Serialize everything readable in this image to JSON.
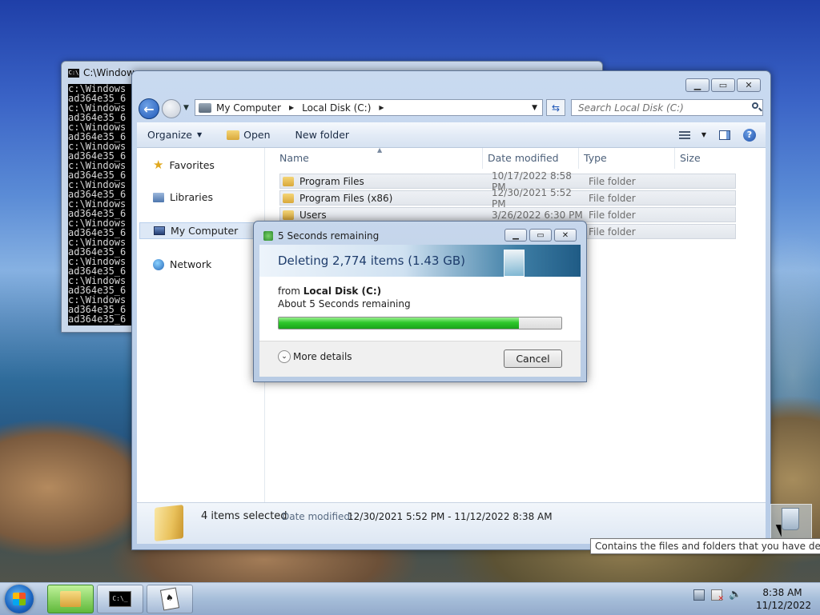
{
  "console": {
    "title": "C:\\Window",
    "lines": [
      "c:\\Windows",
      "ad364e35_6",
      "c:\\Windows",
      "ad364e35_6",
      "c:\\Windows",
      "ad364e35_6",
      "c:\\Windows",
      "ad364e35_6",
      "c:\\Windows",
      "ad364e35_6",
      "c:\\Windows",
      "ad364e35_6",
      "c:\\Windows",
      "ad364e35_6",
      "c:\\Windows",
      "ad364e35_6",
      "c:\\Windows",
      "ad364e35_6",
      "c:\\Windows",
      "ad364e35_6",
      "c:\\Windows",
      "ad364e35_6",
      "c:\\Windows",
      "ad364e35_6",
      "ad364e35_6"
    ]
  },
  "explorer": {
    "breadcrumb": [
      "My Computer",
      "Local Disk (C:)"
    ],
    "search_placeholder": "Search Local Disk (C:)",
    "toolbar": {
      "organize": "Organize",
      "open": "Open",
      "new_folder": "New folder"
    },
    "nav": {
      "favorites": "Favorites",
      "libraries": "Libraries",
      "my_computer": "My Computer",
      "network": "Network"
    },
    "columns": {
      "name": "Name",
      "date": "Date modified",
      "type": "Type",
      "size": "Size"
    },
    "rows": [
      {
        "name": "Program Files",
        "date": "10/17/2022 8:58 PM",
        "type": "File folder"
      },
      {
        "name": "Program Files (x86)",
        "date": "12/30/2021 5:52 PM",
        "type": "File folder"
      },
      {
        "name": "Users",
        "date": "3/26/2022 6:30 PM",
        "type": "File folder"
      },
      {
        "name": "",
        "date": "",
        "type": "File folder"
      }
    ],
    "status": {
      "count": "4 items selected",
      "date_label": "Date modified:",
      "date_range": "12/30/2021 5:52 PM - 11/12/2022 8:38 AM"
    }
  },
  "dialog": {
    "title": "5 Seconds remaining",
    "heading": "Deleting 2,774 items (1.43 GB)",
    "from_prefix": "from",
    "from_location": "Local Disk (C:)",
    "remaining": "About 5 Seconds remaining",
    "progress_percent": 85,
    "more_details": "More details",
    "cancel": "Cancel"
  },
  "tooltip": "Contains the files and folders that you have deleted.",
  "taskbar": {
    "time": "8:38 AM",
    "date": "11/12/2022"
  },
  "colors": {
    "progress_green": "#2ec82b",
    "selection": "#dde8f6",
    "title_blue": "#1e3c6b"
  }
}
